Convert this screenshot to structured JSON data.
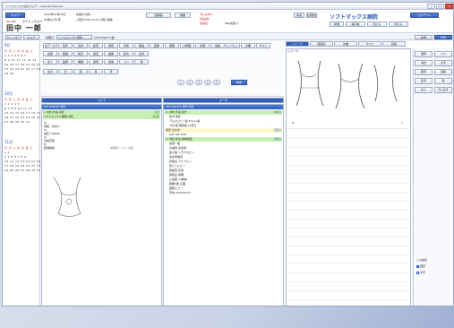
{
  "window": {
    "title": "ソフトマックス電子カルテ - Internet Explorer",
    "min": "_",
    "max": "□",
    "close": "×"
  },
  "header": {
    "patient_id": "9b 100",
    "patient_name": "田中 一郎",
    "kana": "タナカ イチロウ",
    "birth": "1950年01月01日",
    "age_sex": "63歳9ヶ月 男",
    "visit": "診療日:内科",
    "status": "入院日:H25.12.15 (2階) 病棟",
    "alert": "西病棟",
    "alert2": "重要",
    "allergy": "アレルギー",
    "allergy_val": "食品(卵)",
    "infection": "感染症",
    "infection_val": "HBs抗原(-)",
    "hospital": "ソフトマックス病院",
    "logout": "ログアウト",
    "new_user": "新規",
    "close_chart": "閉じる",
    "tools": [
      "情報",
      "記録照会",
      "掲示板",
      "閉じる"
    ]
  },
  "toolbar": {
    "calendar": "カレンダー",
    "tab1": "カルテ",
    "date_label": "記載日:",
    "date_val": "2013/09/27 (金)",
    "dept": "ソフトマックス病院",
    "new_btn": "新規",
    "record_btn": "記録"
  },
  "calendar": {
    "months": [
      {
        "label": "9月",
        "days": [
          "日 月 火 水 木 金 土",
          "1 2 3 4 5 6 7",
          "8 9 10 11 12 13 14",
          "15 16 17 18 19 20 21",
          "22 23 24 25 26 27 28",
          "29 30"
        ]
      },
      {
        "label": "10月",
        "days": [
          "日 月 火 水 木 金 土",
          "1 2 3 4 5",
          "6 7 8 9 10 11 12",
          "13 14 15 16 17 18 19",
          "20 21 22 23 24 25 26",
          "27 28 29 30 31"
        ]
      },
      {
        "label": "11月",
        "days": [
          "日 月 火 水 木 金 土",
          "1 2",
          "3 4 5 6 7 8 9",
          "10 11 12 13 14 15 16",
          "17 18 19 20 21 22 23",
          "24 25 26 27 28 29 30"
        ]
      }
    ]
  },
  "filters": {
    "row1": [
      "全データ",
      "指示",
      "注射",
      "処置",
      "検査",
      "手術",
      "輸血",
      "画像",
      "病理",
      "内視鏡",
      "生理",
      "栄養",
      "リハビリ",
      "文書",
      "サマリ"
    ],
    "row2": [
      "記録",
      "経過",
      "指示",
      "検査",
      "画像",
      "処方",
      "注射"
    ],
    "row3": [
      "全て",
      "医師",
      "看護",
      "薬剤",
      "栄養",
      "リハ",
      "他"
    ],
    "row4": [
      "表示",
      "日",
      "週",
      "月",
      "年"
    ],
    "nums": [
      "1",
      "2",
      "3",
      "4",
      "5"
    ],
    "search": "検索"
  },
  "karte_left": {
    "tab": "カルテ",
    "header": "2013/09/27 内科",
    "entries": [
      {
        "line": "1. 内科 外来 初診",
        "tag": "[初]"
      },
      {
        "line": "ソフトマックス病院 内科",
        "tag": "[外来]"
      }
    ],
    "soap": [
      "S)",
      "頭痛、めまい",
      "O)",
      "血圧 148/90",
      "A)",
      "高血圧症",
      "P)",
      "経過観察"
    ],
    "sign": "記載者:ソフト 太郎"
  },
  "orders": {
    "tab": "オーダ",
    "header": "2013/09/27 内科 外来",
    "items": [
      {
        "text": "2. 内科 外来 処方",
        "tag": "[中止]",
        "style": "green"
      },
      {
        "text": "処方 院外",
        "tag": "",
        "style": ""
      },
      {
        "text": "アムロジピン錠 5mg 1錠",
        "tag": "",
        "style": ""
      },
      {
        "text": "1日1回 朝食後 14日分",
        "tag": "",
        "style": ""
      },
      {
        "text": "検査 生化学",
        "tag": "[至急]",
        "style": "yellow"
      },
      {
        "text": "AST ALT LDH",
        "tag": "",
        "style": ""
      },
      {
        "text": "3. 内科 外来 検体検査",
        "tag": "[中止]",
        "style": "green"
      },
      {
        "text": "血液一般",
        "tag": "",
        "style": ""
      },
      {
        "text": "白血球 赤血球",
        "tag": "",
        "style": ""
      },
      {
        "text": "血小板 ヘモグロビン",
        "tag": "",
        "style": ""
      },
      {
        "text": "生化学検査",
        "tag": "",
        "style": ""
      },
      {
        "text": "総蛋白 アルブミン",
        "tag": "",
        "style": ""
      },
      {
        "text": "総ビリルビン",
        "tag": "",
        "style": ""
      },
      {
        "text": "尿検査 定性",
        "tag": "",
        "style": ""
      },
      {
        "text": "尿蛋白 尿糖",
        "tag": "",
        "style": ""
      },
      {
        "text": "心電図 12誘導",
        "tag": "",
        "style": ""
      },
      {
        "text": "胸部X線 正面",
        "tag": "",
        "style": ""
      },
      {
        "text": "腹部エコー",
        "tag": "",
        "style": ""
      },
      {
        "text": "予約 2013/10/11",
        "tag": "",
        "style": ""
      }
    ]
  },
  "right_tabs": [
    "シェーマ",
    "経過表",
    "文書",
    "サマリ",
    "記録"
  ],
  "shema": {
    "title": "シェーマ",
    "front": "前",
    "back": "後",
    "right": "R",
    "left": "L"
  },
  "palette": {
    "tools": [
      "選択",
      "ペン",
      "消去",
      "文字",
      "図形",
      "直線",
      "矢印",
      "色",
      "太さ",
      "元に戻す"
    ],
    "bottom_label": "入力設定",
    "opt1": "図形",
    "opt2": "文字"
  }
}
